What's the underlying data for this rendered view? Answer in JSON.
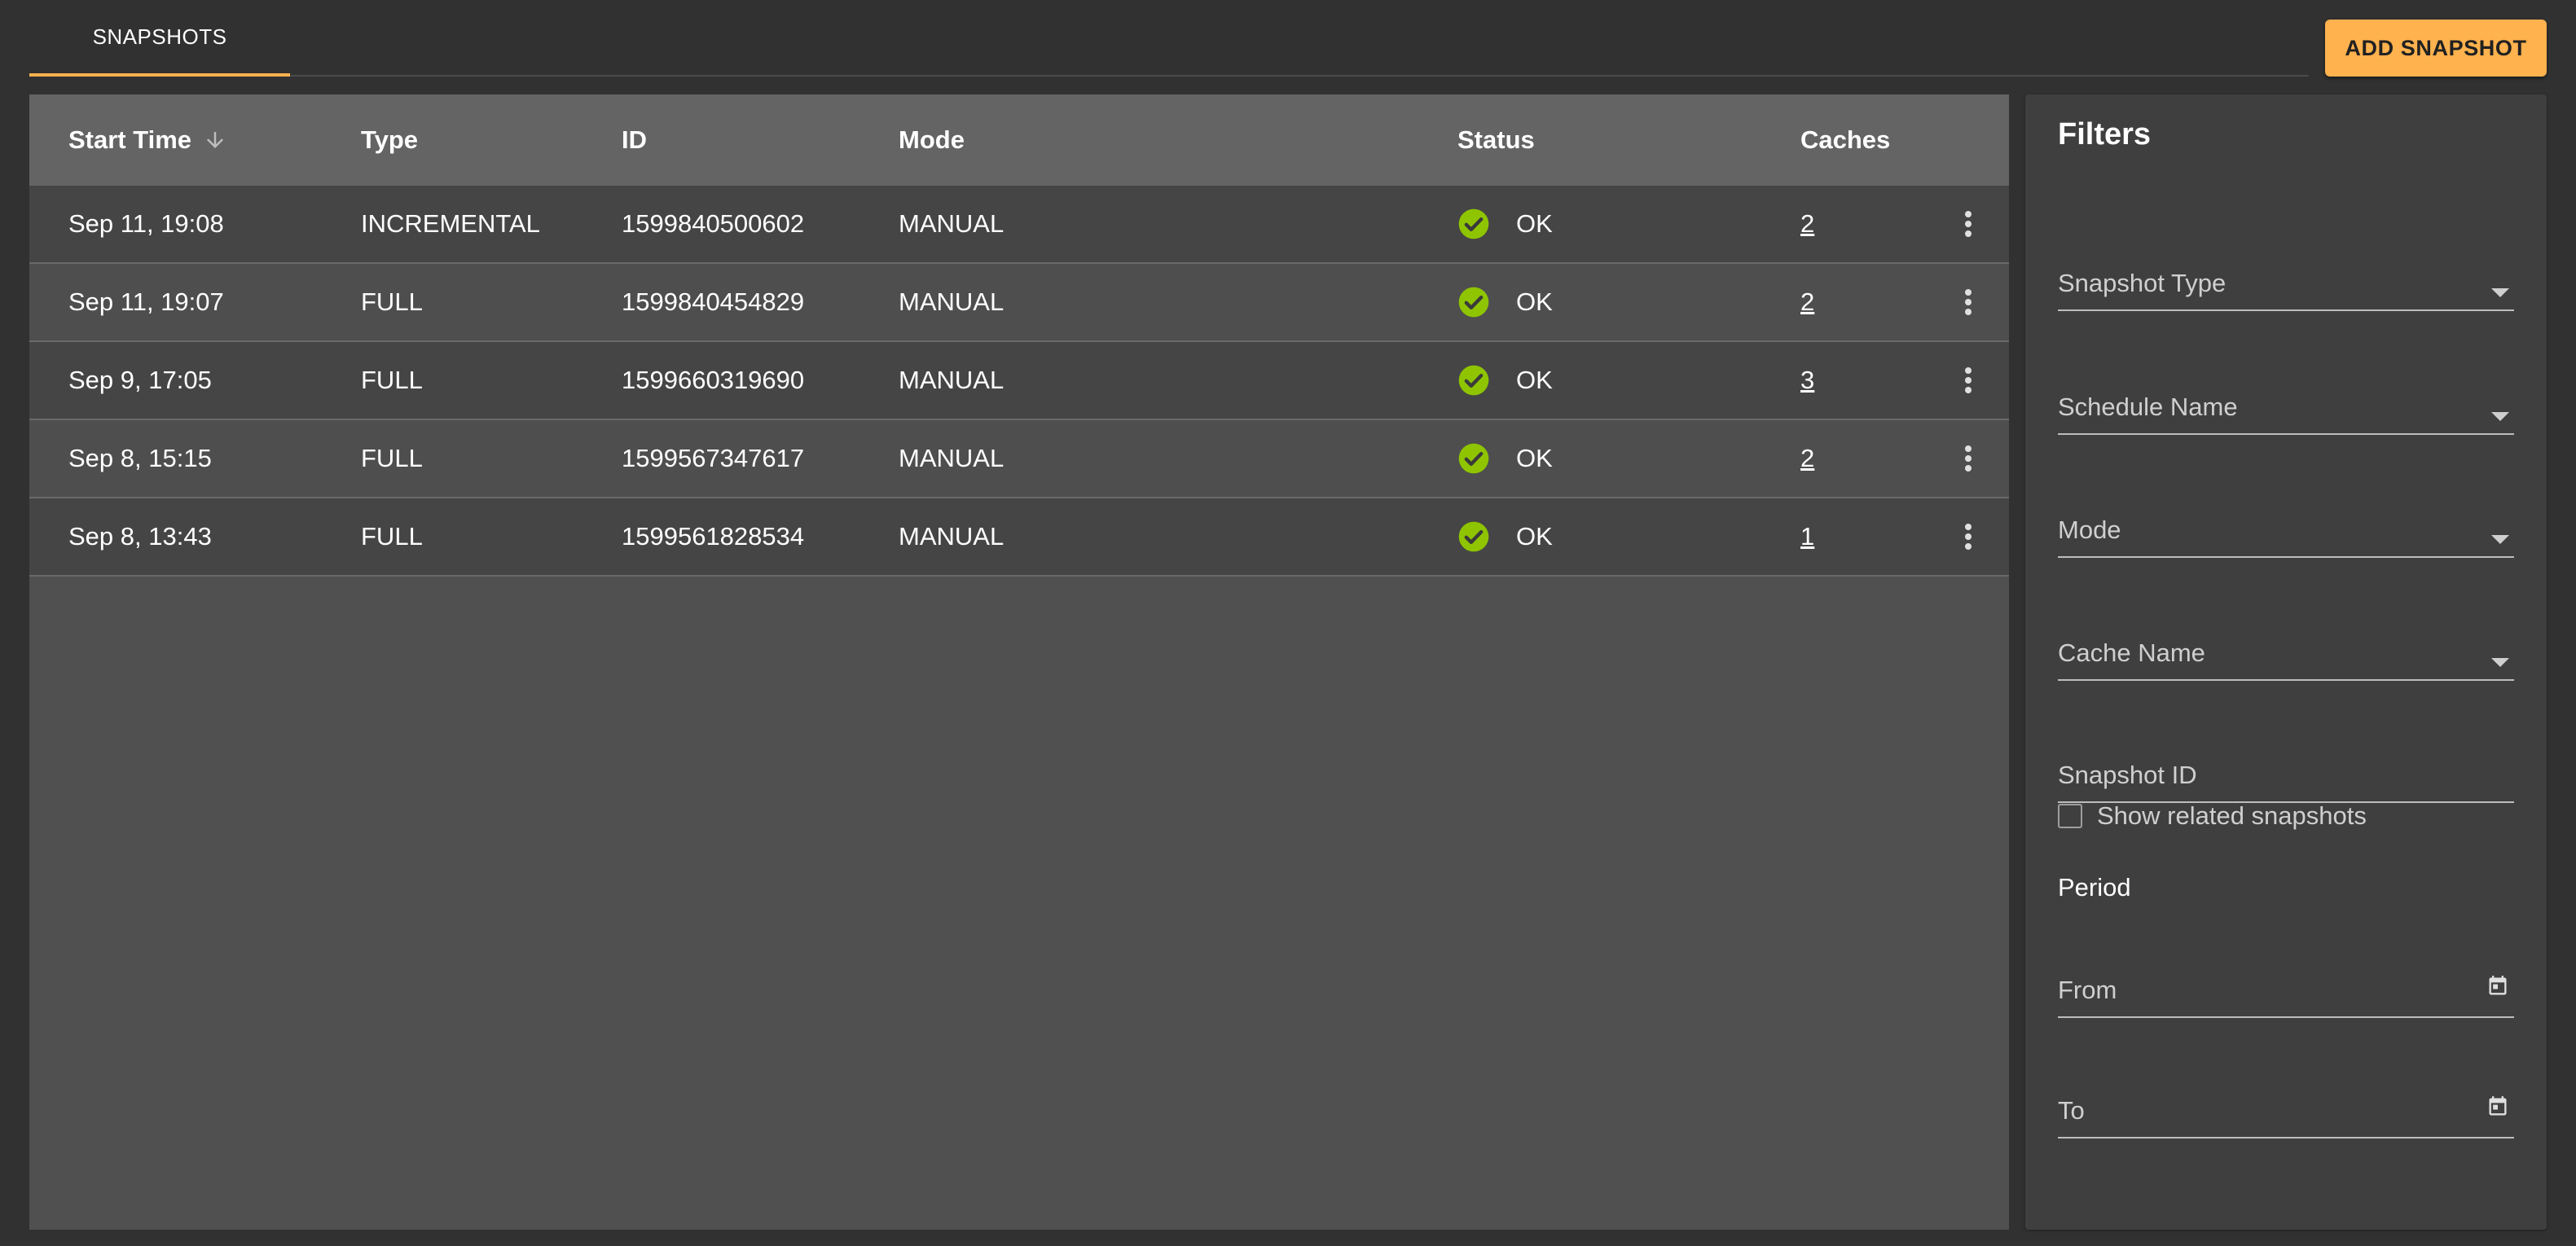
{
  "tabs": [
    {
      "label": "SNAPSHOTS",
      "active": true
    }
  ],
  "actions": {
    "add_snapshot_label": "ADD SNAPSHOT"
  },
  "colors": {
    "accent": "#ffb24e",
    "status_ok": "#8ec400"
  },
  "table": {
    "columns": {
      "start_time": "Start Time",
      "type": "Type",
      "id": "ID",
      "mode": "Mode",
      "status": "Status",
      "caches": "Caches"
    },
    "sort": {
      "column": "start_time",
      "direction": "descending",
      "icon": "arrow-down-icon"
    },
    "rows": [
      {
        "start_time": "Sep 11, 19:08",
        "type": "INCREMENTAL",
        "id": "1599840500602",
        "mode": "MANUAL",
        "status": "OK",
        "caches": "2"
      },
      {
        "start_time": "Sep 11, 19:07",
        "type": "FULL",
        "id": "1599840454829",
        "mode": "MANUAL",
        "status": "OK",
        "caches": "2"
      },
      {
        "start_time": "Sep 9, 17:05",
        "type": "FULL",
        "id": "1599660319690",
        "mode": "MANUAL",
        "status": "OK",
        "caches": "3"
      },
      {
        "start_time": "Sep 8, 15:15",
        "type": "FULL",
        "id": "1599567347617",
        "mode": "MANUAL",
        "status": "OK",
        "caches": "2"
      },
      {
        "start_time": "Sep 8, 13:43",
        "type": "FULL",
        "id": "1599561828534",
        "mode": "MANUAL",
        "status": "OK",
        "caches": "1"
      }
    ]
  },
  "filters": {
    "title": "Filters",
    "snapshot_type": "Snapshot Type",
    "schedule_name": "Schedule Name",
    "mode": "Mode",
    "cache_name": "Cache Name",
    "snapshot_id": "Snapshot ID",
    "show_related": "Show related snapshots",
    "show_related_checked": false,
    "period": "Period",
    "from": "From",
    "to": "To"
  }
}
